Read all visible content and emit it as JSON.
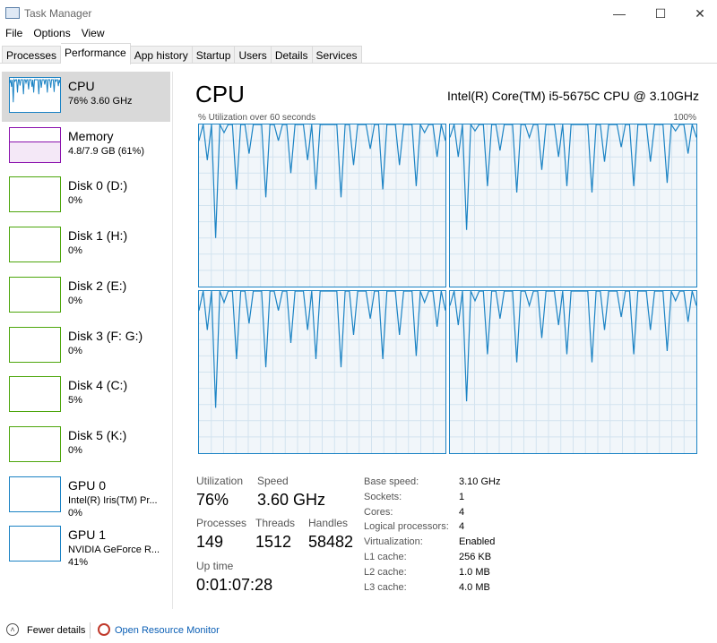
{
  "window": {
    "title": "Task Manager",
    "minimize": "—",
    "maximize": "☐",
    "close": "✕"
  },
  "menu": [
    "File",
    "Options",
    "View"
  ],
  "tabs": [
    "Processes",
    "Performance",
    "App history",
    "Startup",
    "Users",
    "Details",
    "Services"
  ],
  "active_tab": "Performance",
  "sidebar": [
    {
      "name": "CPU",
      "sub1": "76% 3.60 GHz",
      "color": "#1b83c4",
      "selected": true
    },
    {
      "name": "Memory",
      "sub1": "4.8/7.9 GB (61%)",
      "color": "#8b12ae"
    },
    {
      "name": "Disk 0 (D:)",
      "sub1": "0%",
      "color": "#4da60c"
    },
    {
      "name": "Disk 1 (H:)",
      "sub1": "0%",
      "color": "#4da60c"
    },
    {
      "name": "Disk 2 (E:)",
      "sub1": "0%",
      "color": "#4da60c"
    },
    {
      "name": "Disk 3 (F: G:)",
      "sub1": "0%",
      "color": "#4da60c"
    },
    {
      "name": "Disk 4 (C:)",
      "sub1": "5%",
      "color": "#4da60c"
    },
    {
      "name": "Disk 5 (K:)",
      "sub1": "0%",
      "color": "#4da60c"
    },
    {
      "name": "GPU 0",
      "sub1": "Intel(R) Iris(TM) Pr...",
      "sub2": "0%",
      "color": "#1b83c4"
    },
    {
      "name": "GPU 1",
      "sub1": "NVIDIA GeForce R...",
      "sub2": "41%",
      "color": "#1b83c4"
    }
  ],
  "main": {
    "title": "CPU",
    "cpu_name": "Intel(R) Core(TM) i5-5675C CPU @ 3.10GHz",
    "axis_label": "% Utilization over 60 seconds",
    "axis_max": "100%"
  },
  "chart_data": {
    "type": "line",
    "ylim": [
      0,
      100
    ],
    "x_seconds": 60,
    "grid": true,
    "color": "#1b83c4",
    "cores": [
      [
        90,
        100,
        78,
        100,
        30,
        100,
        95,
        100,
        100,
        60,
        100,
        100,
        82,
        100,
        100,
        100,
        55,
        100,
        100,
        90,
        100,
        100,
        70,
        100,
        100,
        100,
        78,
        100,
        60,
        100,
        100,
        100,
        100,
        100,
        55,
        100,
        100,
        75,
        100,
        100,
        100,
        85,
        100,
        100,
        60,
        100,
        100,
        100,
        75,
        100,
        100,
        100,
        62,
        100,
        95,
        100,
        100,
        80,
        100,
        90
      ],
      [
        92,
        100,
        80,
        100,
        35,
        100,
        96,
        100,
        100,
        62,
        100,
        100,
        84,
        100,
        100,
        100,
        58,
        100,
        100,
        92,
        100,
        100,
        72,
        100,
        100,
        100,
        80,
        100,
        62,
        100,
        100,
        100,
        100,
        100,
        58,
        100,
        100,
        77,
        100,
        100,
        100,
        86,
        100,
        100,
        62,
        100,
        100,
        100,
        77,
        100,
        100,
        100,
        64,
        100,
        96,
        100,
        100,
        82,
        100,
        92
      ],
      [
        88,
        100,
        76,
        100,
        28,
        100,
        93,
        100,
        100,
        58,
        100,
        100,
        80,
        100,
        100,
        100,
        53,
        100,
        100,
        88,
        100,
        100,
        68,
        100,
        100,
        100,
        76,
        100,
        58,
        100,
        100,
        100,
        100,
        100,
        53,
        100,
        100,
        73,
        100,
        100,
        100,
        83,
        100,
        100,
        58,
        100,
        100,
        100,
        73,
        100,
        100,
        100,
        60,
        100,
        93,
        100,
        100,
        78,
        100,
        88
      ],
      [
        91,
        100,
        79,
        100,
        32,
        100,
        94,
        100,
        100,
        61,
        100,
        100,
        83,
        100,
        100,
        100,
        56,
        100,
        100,
        91,
        100,
        100,
        71,
        100,
        100,
        100,
        79,
        100,
        61,
        100,
        100,
        100,
        100,
        100,
        56,
        100,
        100,
        76,
        100,
        100,
        100,
        84,
        100,
        100,
        61,
        100,
        100,
        100,
        76,
        100,
        100,
        100,
        63,
        100,
        94,
        100,
        100,
        81,
        100,
        91
      ]
    ]
  },
  "stats": {
    "utilization_label": "Utilization",
    "utilization": "76%",
    "speed_label": "Speed",
    "speed": "3.60 GHz",
    "processes_label": "Processes",
    "processes": "149",
    "threads_label": "Threads",
    "threads": "1512",
    "handles_label": "Handles",
    "handles": "58482",
    "uptime_label": "Up time",
    "uptime": "0:01:07:28"
  },
  "specs": [
    {
      "k": "Base speed:",
      "v": "3.10 GHz"
    },
    {
      "k": "Sockets:",
      "v": "1"
    },
    {
      "k": "Cores:",
      "v": "4"
    },
    {
      "k": "Logical processors:",
      "v": "4"
    },
    {
      "k": "Virtualization:",
      "v": "Enabled"
    },
    {
      "k": "L1 cache:",
      "v": "256 KB"
    },
    {
      "k": "L2 cache:",
      "v": "1.0 MB"
    },
    {
      "k": "L3 cache:",
      "v": "4.0 MB"
    }
  ],
  "footer": {
    "fewer": "Fewer details",
    "monitor": "Open Resource Monitor"
  }
}
